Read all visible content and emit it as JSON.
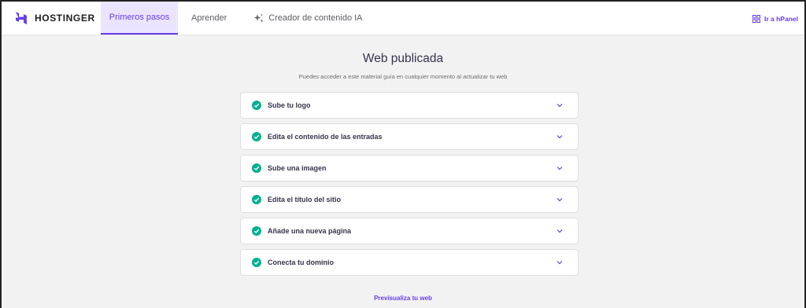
{
  "brand": {
    "name": "HOSTINGER",
    "logo_icon": "hostinger-logo",
    "color": "#673de6"
  },
  "nav": {
    "items": [
      {
        "label": "Primeros pasos",
        "active": true
      },
      {
        "label": "Aprender",
        "active": false
      },
      {
        "label": "Creador de contenido IA",
        "active": false,
        "icon": "sparkle-icon"
      }
    ]
  },
  "hpanel": {
    "label": "Ir a hPanel",
    "icon": "grid-icon"
  },
  "main": {
    "title": "Web publicada",
    "subtitle": "Puedes acceder a este material guía en cualquier momento al actualizar tu web",
    "steps": [
      {
        "label": "Sube tu logo",
        "done": true
      },
      {
        "label": "Edita el contenido de las entradas",
        "done": true
      },
      {
        "label": "Sube una imagen",
        "done": true
      },
      {
        "label": "Edita el título del sitio",
        "done": true
      },
      {
        "label": "Añade una nueva página",
        "done": true
      },
      {
        "label": "Conecta tu dominio",
        "done": true
      }
    ],
    "preview_link": "Previsualiza tu web"
  },
  "colors": {
    "accent": "#673de6",
    "success": "#00b090",
    "active_tab_bg": "#ebe4ff"
  }
}
